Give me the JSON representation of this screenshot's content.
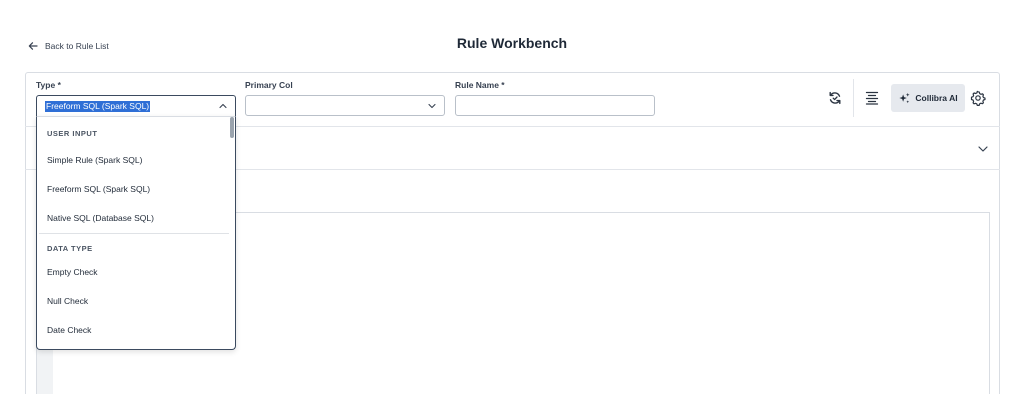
{
  "header": {
    "back_label": "Back to Rule List",
    "title": "Rule Workbench"
  },
  "form": {
    "type_label": "Type *",
    "type_value": "Freeform SQL (Spark SQL)",
    "primary_col_label": "Primary Col",
    "primary_col_value": "",
    "rule_name_label": "Rule Name *",
    "rule_name_value": ""
  },
  "toolbar": {
    "ai_label": "Collibra AI"
  },
  "dropdown": {
    "groups": [
      {
        "label": "USER INPUT",
        "items": [
          "Simple Rule (Spark SQL)",
          "Freeform SQL (Spark SQL)",
          "Native SQL (Database SQL)"
        ]
      },
      {
        "label": "DATA TYPE",
        "items": [
          "Empty Check",
          "Null Check",
          "Date Check"
        ]
      }
    ]
  },
  "icons": {
    "back": "arrow-left-icon",
    "type_chevron": "chevron-up-icon",
    "primary_chevron": "chevron-down-icon",
    "refresh": "refresh-icon",
    "format": "align-center-icon",
    "ai": "sparkle-icon",
    "settings": "gear-icon",
    "expand": "chevron-down-icon"
  },
  "colors": {
    "selection_highlight": "#2f6fd6",
    "focus_border": "#3b4a5f",
    "ai_button_bg": "#e6e9ee"
  }
}
